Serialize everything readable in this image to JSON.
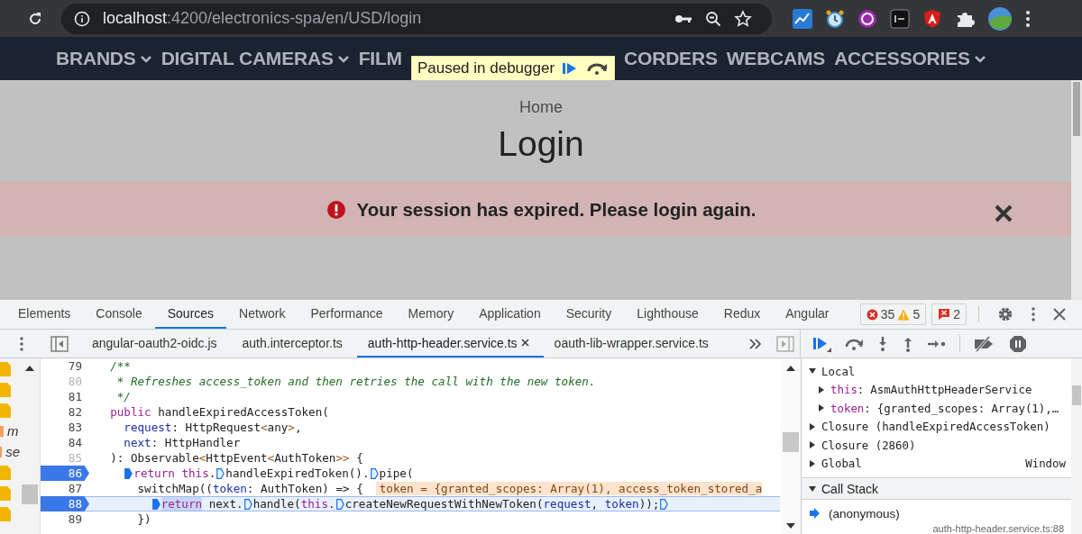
{
  "browser": {
    "url_host": "localhost",
    "url_path": ":4200/electronics-spa/en/USD/login"
  },
  "page": {
    "paused": true,
    "nav": [
      {
        "kind": "link",
        "label": "BRANDS",
        "has_menu": true
      },
      {
        "kind": "link",
        "label": "DIGITAL CAMERAS",
        "has_menu": true
      },
      {
        "kind": "link",
        "label": "FILM",
        "has_menu": false
      },
      {
        "kind": "paused_banner",
        "label": "Paused in debugger"
      },
      {
        "kind": "link",
        "label": "CORDERS",
        "has_menu": false
      },
      {
        "kind": "link",
        "label": "WEBCAMS",
        "has_menu": false
      },
      {
        "kind": "link",
        "label": "ACCESSORIES",
        "has_menu": true
      }
    ],
    "breadcrumb": "Home",
    "title": "Login",
    "alert": {
      "message": "Your session has expired. Please login again.",
      "dismissible": true
    }
  },
  "devtools": {
    "tabs": [
      {
        "label": "Elements",
        "selected": false
      },
      {
        "label": "Console",
        "selected": false
      },
      {
        "label": "Sources",
        "selected": true
      },
      {
        "label": "Network",
        "selected": false
      },
      {
        "label": "Performance",
        "selected": false
      },
      {
        "label": "Memory",
        "selected": false
      },
      {
        "label": "Application",
        "selected": false
      },
      {
        "label": "Security",
        "selected": false
      },
      {
        "label": "Lighthouse",
        "selected": false
      },
      {
        "label": "Redux",
        "selected": false
      },
      {
        "label": "Angular",
        "selected": false
      }
    ],
    "counts": {
      "errors": "35",
      "warnings": "5",
      "issues": "2"
    },
    "file_tabs": [
      {
        "label": "angular-oauth2-oidc.js",
        "selected": false,
        "closable": false
      },
      {
        "label": "auth.interceptor.ts",
        "selected": false,
        "closable": false
      },
      {
        "label": "auth-http-header.service.ts",
        "selected": true,
        "closable": true
      },
      {
        "label": "oauth-lib-wrapper.service.ts",
        "selected": false,
        "closable": false
      }
    ],
    "navigator": [
      {
        "kind": "file"
      },
      {
        "kind": "file"
      },
      {
        "kind": "file"
      },
      {
        "kind": "text",
        "text": "m"
      },
      {
        "kind": "text",
        "text": "se"
      },
      {
        "kind": "file"
      },
      {
        "kind": "file"
      },
      {
        "kind": "file"
      }
    ],
    "code_lines": [
      {
        "number": "79",
        "mapped": true,
        "breakpoint": false,
        "current": false,
        "segments": [
          {
            "kind": "comment",
            "text": "  /**"
          }
        ]
      },
      {
        "number": "80",
        "mapped": false,
        "breakpoint": false,
        "current": false,
        "segments": [
          {
            "kind": "comment",
            "text": "   * Refreshes access_token and then retries the call with the new token."
          }
        ]
      },
      {
        "number": "81",
        "mapped": true,
        "breakpoint": false,
        "current": false,
        "segments": [
          {
            "kind": "comment",
            "text": "   */"
          }
        ]
      },
      {
        "number": "82",
        "mapped": true,
        "breakpoint": false,
        "current": false,
        "segments": [
          {
            "kind": "keyword",
            "text": "  public"
          },
          {
            "kind": "plain",
            "text": " handleExpiredAccessToken("
          }
        ]
      },
      {
        "number": "83",
        "mapped": true,
        "breakpoint": false,
        "current": false,
        "segments": [
          {
            "kind": "param",
            "text": "    request"
          },
          {
            "kind": "plain",
            "text": ": HttpRequest"
          },
          {
            "kind": "punct",
            "text": "<"
          },
          {
            "kind": "plain",
            "text": "any"
          },
          {
            "kind": "punct",
            "text": ">"
          },
          {
            "kind": "plain",
            "text": ","
          }
        ]
      },
      {
        "number": "84",
        "mapped": true,
        "breakpoint": false,
        "current": false,
        "segments": [
          {
            "kind": "param",
            "text": "    next"
          },
          {
            "kind": "plain",
            "text": ": HttpHandler"
          }
        ]
      },
      {
        "number": "85",
        "mapped": false,
        "breakpoint": false,
        "current": false,
        "segments": [
          {
            "kind": "plain",
            "text": "  ): Observable"
          },
          {
            "kind": "punct",
            "text": "<"
          },
          {
            "kind": "plain",
            "text": "HttpEvent"
          },
          {
            "kind": "punct",
            "text": "<"
          },
          {
            "kind": "plain",
            "text": "AuthToken"
          },
          {
            "kind": "punct",
            "text": ">>"
          },
          {
            "kind": "plain",
            "text": " {"
          }
        ]
      },
      {
        "number": "86",
        "mapped": true,
        "breakpoint": true,
        "current": false,
        "segments": [
          {
            "kind": "indent"
          },
          {
            "kind": "indent"
          },
          {
            "kind": "marker",
            "active": true
          },
          {
            "kind": "keyword",
            "text": "return this"
          },
          {
            "kind": "plain",
            "text": "."
          },
          {
            "kind": "marker",
            "active": false
          },
          {
            "kind": "plain",
            "text": "handleExpiredToken()."
          },
          {
            "kind": "marker",
            "active": false
          },
          {
            "kind": "plain",
            "text": "pipe("
          }
        ]
      },
      {
        "number": "87",
        "mapped": true,
        "breakpoint": false,
        "current": false,
        "segments": [
          {
            "kind": "plain",
            "text": "      switchMap(("
          },
          {
            "kind": "param",
            "text": "token"
          },
          {
            "kind": "plain",
            "text": ": AuthToken) => {"
          },
          {
            "kind": "inline_value",
            "text": "token = {granted_scopes: Array(1), access_token_stored_a"
          }
        ]
      },
      {
        "number": "88",
        "mapped": true,
        "breakpoint": true,
        "current": true,
        "segments": [
          {
            "kind": "indent"
          },
          {
            "kind": "indent"
          },
          {
            "kind": "indent"
          },
          {
            "kind": "indent"
          },
          {
            "kind": "marker",
            "active": true
          },
          {
            "kind": "selected_keyword",
            "text": "return"
          },
          {
            "kind": "plain",
            "text": " next."
          },
          {
            "kind": "marker",
            "active": false
          },
          {
            "kind": "plain",
            "text": "handle("
          },
          {
            "kind": "keyword",
            "text": "this"
          },
          {
            "kind": "plain",
            "text": "."
          },
          {
            "kind": "marker",
            "active": false
          },
          {
            "kind": "plain",
            "text": "createNewRequestWithNewToken("
          },
          {
            "kind": "param",
            "text": "request"
          },
          {
            "kind": "plain",
            "text": ", "
          },
          {
            "kind": "param",
            "text": "token"
          },
          {
            "kind": "plain",
            "text": "));"
          },
          {
            "kind": "marker",
            "active": false
          }
        ]
      },
      {
        "number": "89",
        "mapped": true,
        "breakpoint": false,
        "current": false,
        "segments": [
          {
            "kind": "plain",
            "text": "      })"
          }
        ]
      }
    ],
    "scope": [
      {
        "label": "Local",
        "expanded": true,
        "children": [
          {
            "name": "this",
            "separator": ":",
            "value": "AsmAuthHttpHeaderService",
            "expanded": false
          },
          {
            "name": "token",
            "separator": ":",
            "value": "{granted_scopes: Array(1),…",
            "expanded": false
          }
        ]
      },
      {
        "label": "Closure (handleExpiredAccessToken)",
        "expanded": false
      },
      {
        "label": "Closure (2860)",
        "expanded": false
      },
      {
        "label": "Global",
        "value": "Window",
        "expanded": false
      }
    ],
    "call_stack": {
      "title": "Call Stack",
      "expanded": true,
      "frames": [
        {
          "name": "(anonymous)",
          "location": "auth-http-header.service.ts:88",
          "current": true
        }
      ]
    }
  }
}
